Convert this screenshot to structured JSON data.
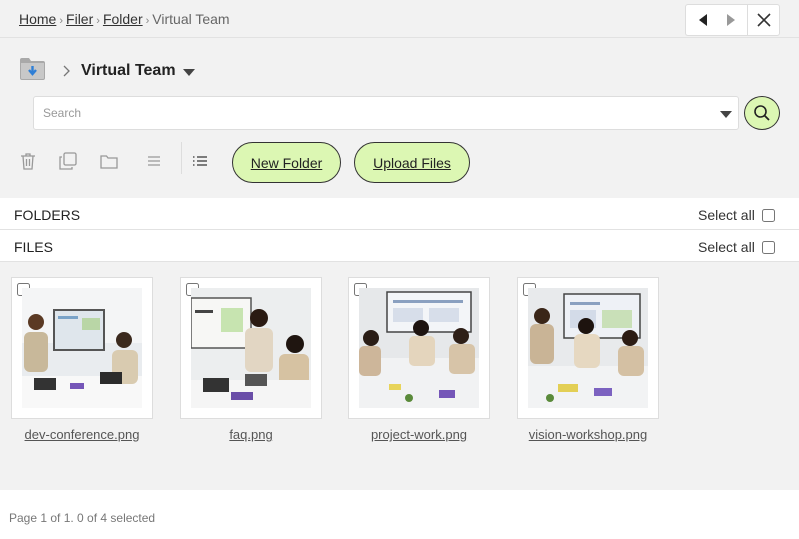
{
  "breadcrumb": {
    "items": [
      "Home",
      "Filer",
      "Folder"
    ],
    "current": "Virtual Team"
  },
  "folder": {
    "title": "Virtual Team"
  },
  "search": {
    "placeholder": "Search"
  },
  "toolbar": {
    "new_folder": "New Folder",
    "upload_files": "Upload Files"
  },
  "sections": {
    "folders": "FOLDERS",
    "files": "FILES",
    "select_all": "Select all"
  },
  "files": [
    {
      "name": "dev-conference.png"
    },
    {
      "name": "faq.png"
    },
    {
      "name": "project-work.png"
    },
    {
      "name": "vision-workshop.png"
    }
  ],
  "footer": {
    "status": "Page 1 of 1. 0 of 4 selected"
  },
  "colors": {
    "accent": "#dcf7b3",
    "panel": "#f2f2f2",
    "folder_blue": "#2f7fd6"
  },
  "icons": {
    "folder": "folder-download-icon",
    "search": "search-icon",
    "prev": "caret-left-icon",
    "next": "caret-right-icon",
    "close": "close-icon",
    "trash": "trash-icon",
    "copy": "copy-icon",
    "move": "folder-icon",
    "view_compact": "menu-icon",
    "view_list": "list-icon"
  }
}
